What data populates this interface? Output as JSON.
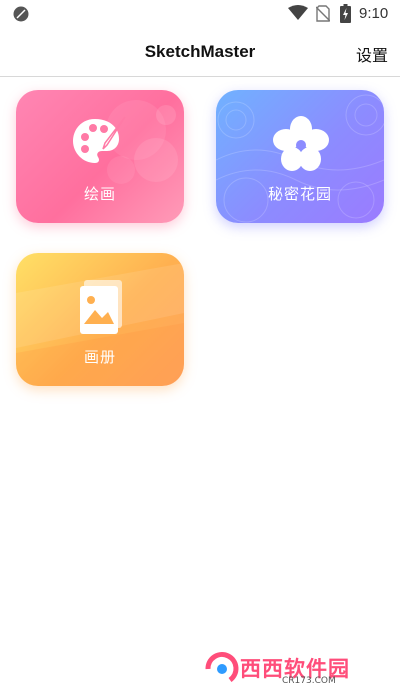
{
  "status_bar": {
    "time": "9:10",
    "icons": [
      "leaf-icon",
      "wifi-icon",
      "no-sim-icon",
      "battery-charging-icon"
    ]
  },
  "app_bar": {
    "title": "SketchMaster",
    "settings_label": "设置"
  },
  "cards": [
    {
      "label": "绘画",
      "icon": "palette-icon",
      "colors": [
        "#ff86b3",
        "#ff6f9e"
      ]
    },
    {
      "label": "秘密花园",
      "icon": "flower-icon",
      "colors": [
        "#70b2ff",
        "#9b7bff"
      ]
    },
    {
      "label": "画册",
      "icon": "album-icon",
      "colors": [
        "#ffe066",
        "#ffa45e"
      ]
    }
  ],
  "watermark": {
    "brand": "西西软件园",
    "site": "CR173.COM"
  }
}
